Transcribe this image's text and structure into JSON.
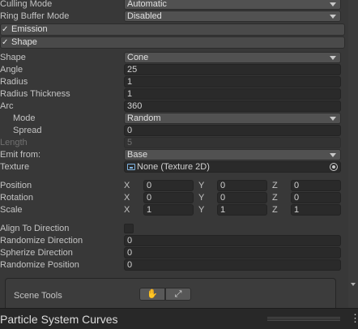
{
  "rows": {
    "culling_mode": {
      "label": "Culling Mode",
      "value": "Automatic"
    },
    "ring_buffer_mode": {
      "label": "Ring Buffer Mode",
      "value": "Disabled"
    }
  },
  "sections": {
    "emission": {
      "label": "Emission",
      "checked": true
    },
    "shape": {
      "label": "Shape",
      "checked": true
    }
  },
  "shape": {
    "shape": {
      "label": "Shape",
      "value": "Cone"
    },
    "angle": {
      "label": "Angle",
      "value": "25"
    },
    "radius": {
      "label": "Radius",
      "value": "1"
    },
    "radius_thickness": {
      "label": "Radius Thickness",
      "value": "1"
    },
    "arc": {
      "label": "Arc",
      "value": "360"
    },
    "mode": {
      "label": "Mode",
      "value": "Random"
    },
    "spread": {
      "label": "Spread",
      "value": "0"
    },
    "length": {
      "label": "Length",
      "value": "5"
    },
    "emit_from": {
      "label": "Emit from:",
      "value": "Base"
    },
    "texture": {
      "label": "Texture",
      "value": "None (Texture 2D)"
    },
    "position": {
      "label": "Position",
      "x": "0",
      "y": "0",
      "z": "0"
    },
    "rotation": {
      "label": "Rotation",
      "x": "0",
      "y": "0",
      "z": "0"
    },
    "scale": {
      "label": "Scale",
      "x": "1",
      "y": "1",
      "z": "1"
    },
    "axis": {
      "x": "X",
      "y": "Y",
      "z": "Z"
    },
    "align_to_direction": {
      "label": "Align To Direction",
      "checked": false
    },
    "randomize_direction": {
      "label": "Randomize Direction",
      "value": "0"
    },
    "spherize_direction": {
      "label": "Spherize Direction",
      "value": "0"
    },
    "randomize_position": {
      "label": "Randomize Position",
      "value": "0"
    }
  },
  "partial_box": {
    "label": "Scene Tools",
    "btn1": "✋",
    "btn2": "⤢"
  },
  "curves_panel": {
    "title": "Particle System Curves",
    "menu_glyph": "⋮"
  },
  "colors": {
    "background": "#383838",
    "field": "#2a2a2a",
    "dropdown": "#515151",
    "section_header": "#4a4a4a"
  }
}
